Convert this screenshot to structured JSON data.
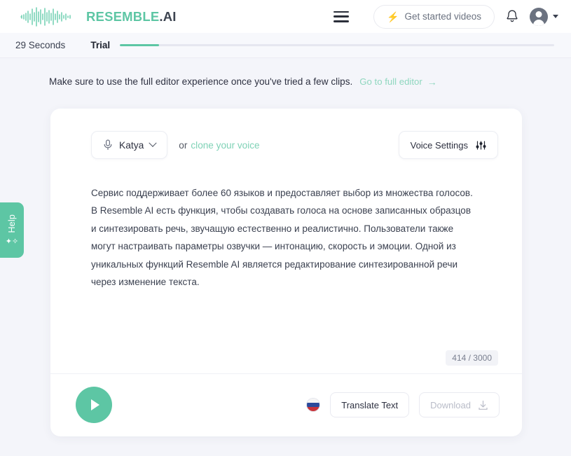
{
  "header": {
    "brand_name_accent": "RESEMBLE",
    "brand_name_rest": ".AI",
    "logo_icon": "waveform-icon",
    "menu_icon": "hamburger-menu-icon",
    "get_started_label": "Get started videos",
    "get_started_icon": "lightning-bolt-icon",
    "notifications_icon": "bell-icon",
    "account_icon": "user-avatar-icon",
    "account_caret_icon": "chevron-down-icon"
  },
  "trial_bar": {
    "seconds_label": "29 Seconds",
    "plan_label": "Trial",
    "progress_percent": 9
  },
  "note": {
    "text": "Make sure to use the full editor experience once you've tried a few clips.",
    "link_label": "Go to full editor",
    "link_arrow": "→"
  },
  "editor": {
    "voice": {
      "icon": "microphone-icon",
      "name": "Katya",
      "caret_icon": "chevron-down-icon"
    },
    "or_label": "or",
    "clone_link_label": "clone your voice",
    "voice_settings_label": "Voice Settings",
    "voice_settings_icon": "sliders-icon",
    "body_text": "Сервис поддерживает более 60 языков и предоставляет выбор из множества голосов. В Resemble AI есть функция, чтобы создавать голоса на основе записанных образцов и синтезировать речь, звучащую естественно и реалистично. Пользователи также могут настраивать параметры озвучки — интонацию, скорость и эмоции. Одной из уникальных функций Resemble AI является редактирование синтезированной речи через изменение текста.",
    "char_counter": "414 / 3000",
    "char_count": 414,
    "char_limit": 3000
  },
  "footer": {
    "play_icon": "play-icon",
    "language_flag": "russia-flag-icon",
    "translate_label": "Translate Text",
    "download_label": "Download",
    "download_icon": "download-icon",
    "download_disabled": true
  },
  "help_tab": {
    "label": "Help",
    "icon": "sparkles-icon"
  },
  "colors": {
    "accent": "#5dc6a4",
    "accent_light": "#8fd7bf",
    "page_bg": "#f4f5fa",
    "card_bg": "#ffffff",
    "text": "#2e3141"
  }
}
